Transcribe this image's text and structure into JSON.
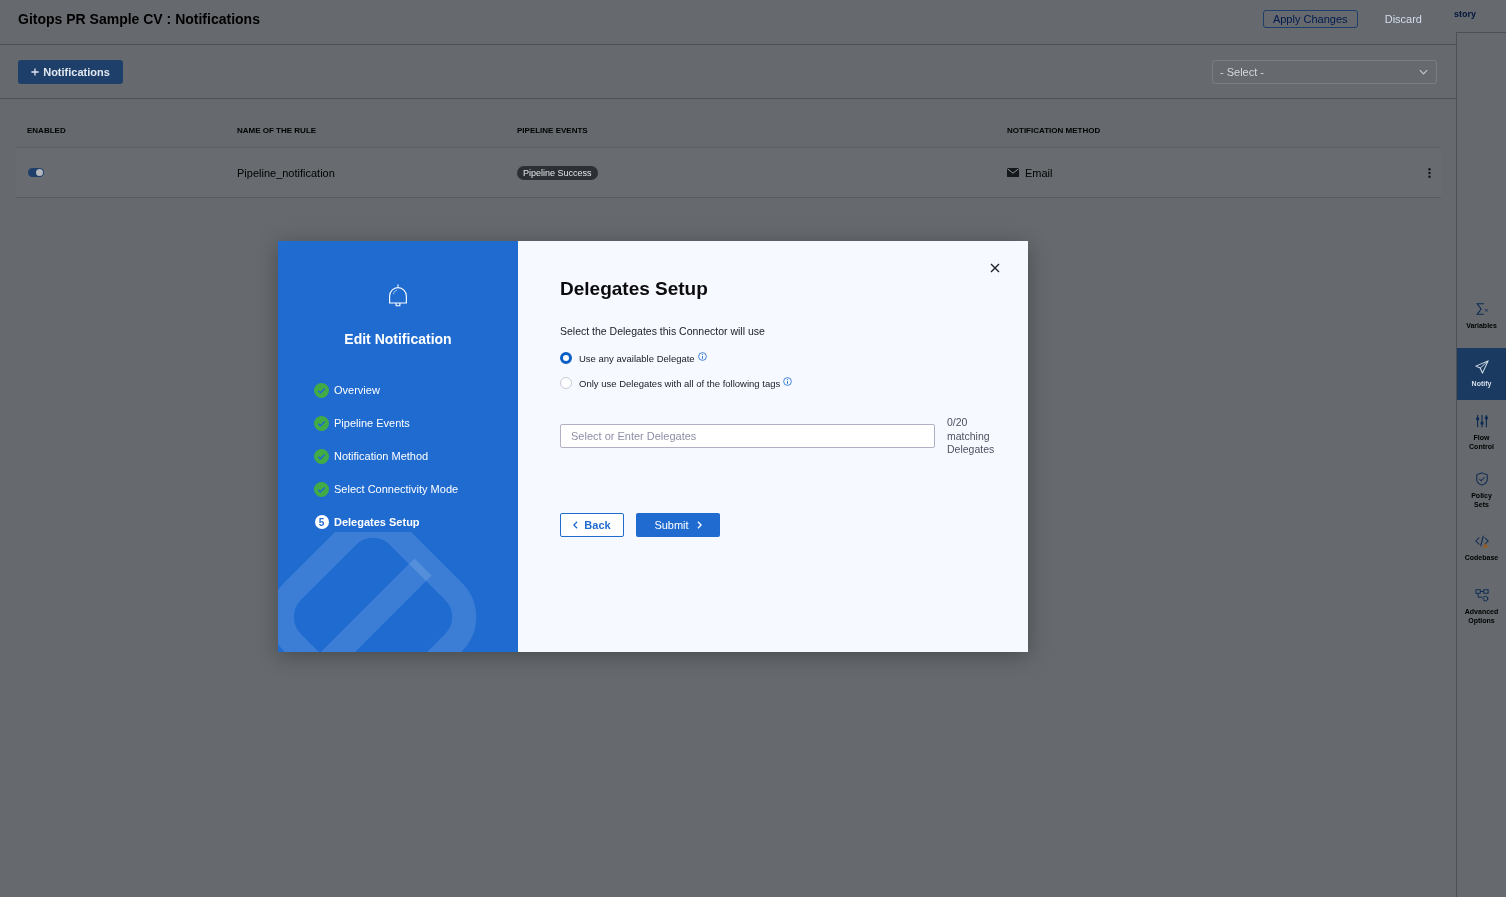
{
  "header": {
    "title": "Gitops PR Sample CV : Notifications",
    "apply_button": "Apply Changes",
    "discard_button": "Discard",
    "side_tab": "story"
  },
  "toolbar": {
    "add_button": "Notifications",
    "select": {
      "placeholder": "- Select -"
    }
  },
  "table": {
    "columns": [
      "ENABLED",
      "NAME OF THE RULE",
      "PIPELINE EVENTS",
      "NOTIFICATION METHOD"
    ],
    "rows": [
      {
        "enabled": true,
        "name": "Pipeline_notification",
        "events": [
          "Pipeline Success"
        ],
        "method": "Email"
      }
    ]
  },
  "right_sidebar": {
    "items": [
      {
        "label": "Variables",
        "selected": false
      },
      {
        "label": "Notify",
        "selected": true
      },
      {
        "label": "Flow Control",
        "selected": false
      },
      {
        "label": "Policy Sets",
        "selected": false
      },
      {
        "label": "Codebase",
        "selected": false
      },
      {
        "label": "Advanced Options",
        "selected": false
      }
    ]
  },
  "modal": {
    "wizard": {
      "title": "Edit Notification",
      "steps": [
        {
          "label": "Overview",
          "completed": true,
          "selected": false
        },
        {
          "label": "Pipeline Events",
          "completed": true,
          "selected": false
        },
        {
          "label": "Notification Method",
          "completed": true,
          "selected": false
        },
        {
          "label": "Select Connectivity Mode",
          "completed": true,
          "selected": false
        },
        {
          "label": "Delegates Setup",
          "completed": false,
          "selected": true,
          "number": "5"
        }
      ]
    },
    "panel": {
      "title": "Delegates Setup",
      "subtitle": "Select the Delegates this Connector will use",
      "options": [
        {
          "label": "Use any available Delegate",
          "selected": true
        },
        {
          "label": "Only use Delegates with all of the following tags",
          "selected": false
        }
      ],
      "delegates_field": {
        "placeholder": "Select or Enter Delegates"
      },
      "match_count": "0/20 matching Delegates",
      "back_button": "Back",
      "submit_button": "Submit"
    }
  }
}
